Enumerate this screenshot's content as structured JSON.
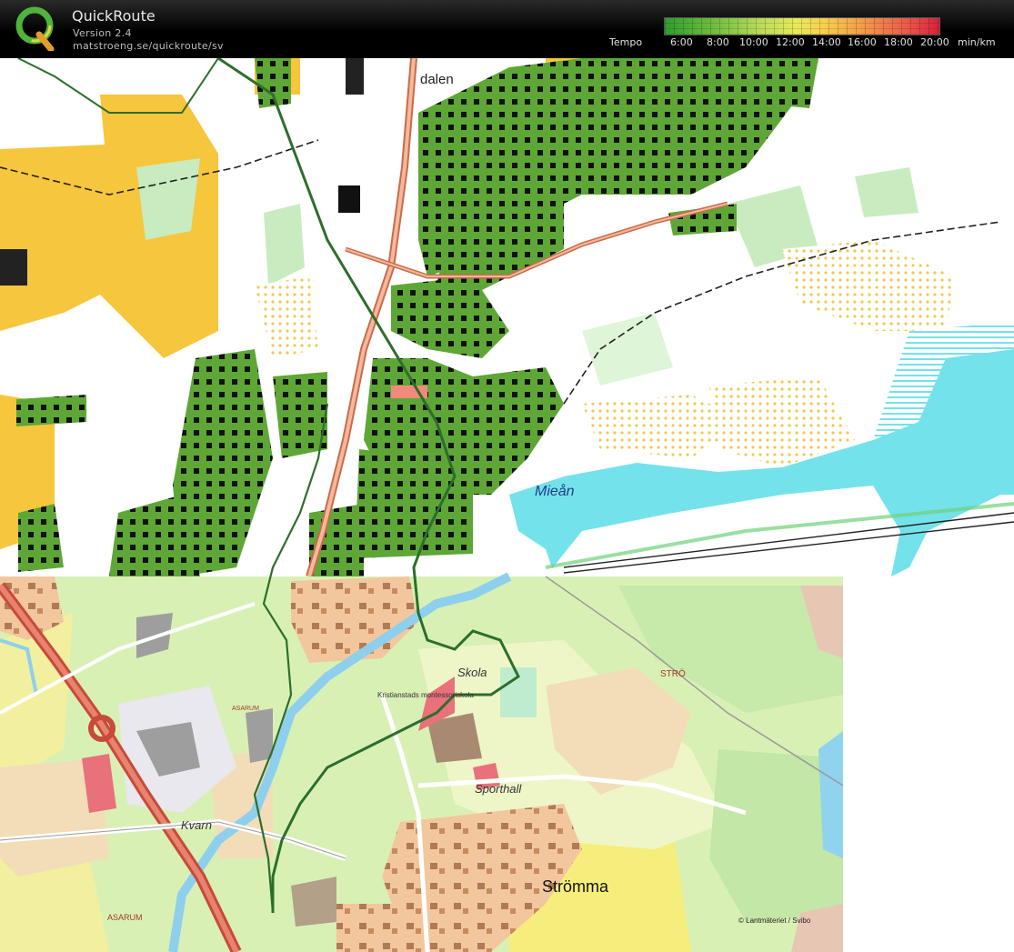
{
  "app": {
    "title": "QuickRoute",
    "version": "Version 2.4",
    "url": "matstroeng.se/quickroute/sv"
  },
  "legend": {
    "label": "Tempo",
    "ticks": [
      "6:00",
      "8:00",
      "10:00",
      "12:00",
      "14:00",
      "16:00",
      "18:00",
      "20:00"
    ],
    "unit": "min/km"
  },
  "map_labels": {
    "dalen": "dalen",
    "miean": "Mieån",
    "skola": "Skola",
    "skola_name": "Kristianstads montessoriskola",
    "sporthall": "Sporthall",
    "stromma": "Strömma",
    "stro": "STRÖ",
    "kvarn": "Kvarn",
    "asarum_top": "ASARUM",
    "asarum_bottom": "ASARUM",
    "copyright": "© Lantmäteriet / Svibo"
  },
  "colors": {
    "header_bg": "#000000",
    "forest_green": "#5ea636",
    "water": "#74e2ea",
    "yellow_open": "#f6c63c",
    "route": "#3d7a2a"
  }
}
